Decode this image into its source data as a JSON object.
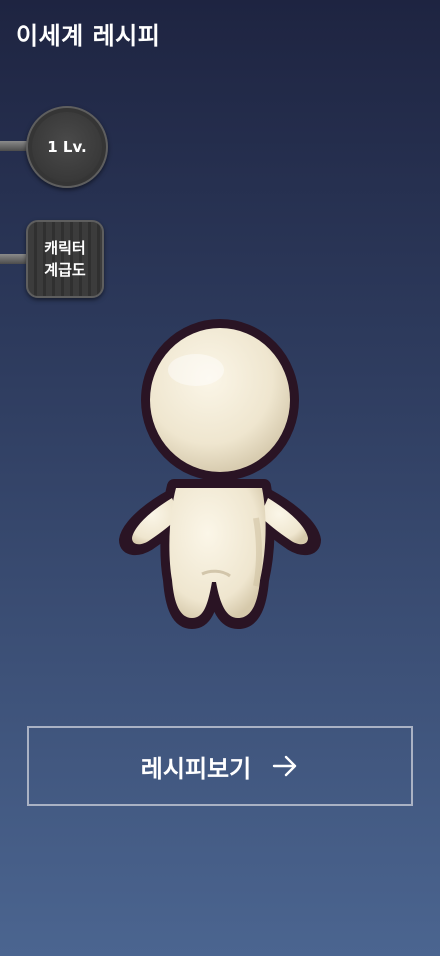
{
  "app": {
    "title": "이세계 레시피"
  },
  "level_pan": {
    "label": "1 Lv."
  },
  "character_pan": {
    "label_line1": "캐릭터",
    "label_line2": "계급도"
  },
  "recipe_button": {
    "label": "레시피보기",
    "icon": "arrow-right-icon"
  },
  "character": {
    "icon": "character-image"
  },
  "colors": {
    "background_top": "#1e2441",
    "background_bottom": "#4b6590",
    "button_border": "#aab2c4",
    "text": "#ffffff"
  }
}
